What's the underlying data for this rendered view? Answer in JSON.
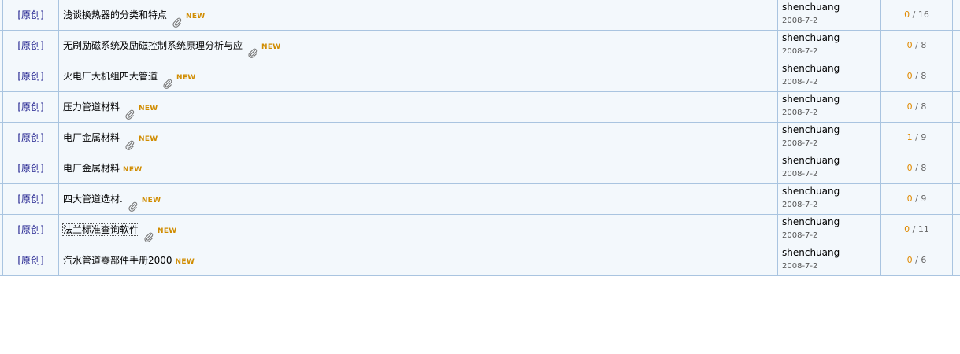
{
  "rows": [
    {
      "type": "[原创]",
      "title": "浅谈换热器的分类和特点",
      "attach": true,
      "new": "NEW",
      "author": "shenchuang",
      "date": "2008-7-2",
      "replies": "0",
      "views": "16",
      "focus": false
    },
    {
      "type": "[原创]",
      "title": "无刷励磁系统及励磁控制系统原理分析与应",
      "attach": true,
      "new": "NEW",
      "author": "shenchuang",
      "date": "2008-7-2",
      "replies": "0",
      "views": "8",
      "focus": false
    },
    {
      "type": "[原创]",
      "title": "火电厂大机组四大管道",
      "attach": true,
      "new": "NEW",
      "author": "shenchuang",
      "date": "2008-7-2",
      "replies": "0",
      "views": "8",
      "focus": false
    },
    {
      "type": "[原创]",
      "title": "压力管道材料",
      "attach": true,
      "new": "NEW",
      "author": "shenchuang",
      "date": "2008-7-2",
      "replies": "0",
      "views": "8",
      "focus": false
    },
    {
      "type": "[原创]",
      "title": "电厂金属材料",
      "attach": true,
      "new": "NEW",
      "author": "shenchuang",
      "date": "2008-7-2",
      "replies": "1",
      "views": "9",
      "focus": false
    },
    {
      "type": "[原创]",
      "title": "电厂金属材料",
      "attach": false,
      "new": "NEW",
      "author": "shenchuang",
      "date": "2008-7-2",
      "replies": "0",
      "views": "8",
      "focus": false
    },
    {
      "type": "[原创]",
      "title": "四大管道选材.",
      "attach": true,
      "new": "NEW",
      "author": "shenchuang",
      "date": "2008-7-2",
      "replies": "0",
      "views": "9",
      "focus": false
    },
    {
      "type": "[原创]",
      "title": "法兰标准查询软件",
      "attach": true,
      "new": "NEW",
      "author": "shenchuang",
      "date": "2008-7-2",
      "replies": "0",
      "views": "11",
      "focus": true
    },
    {
      "type": "[原创]",
      "title": "汽水管道零部件手册2000",
      "attach": false,
      "new": "NEW",
      "author": "shenchuang",
      "date": "2008-7-2",
      "replies": "0",
      "views": "6",
      "focus": false
    }
  ],
  "colors": {
    "row_bg": "#f3f8fc",
    "border": "#a9c4e0",
    "new": "#d08c00",
    "reply": "#e08a00",
    "type_link": "#1a1a8c"
  },
  "icons": {
    "attachment": "paperclip-icon"
  }
}
